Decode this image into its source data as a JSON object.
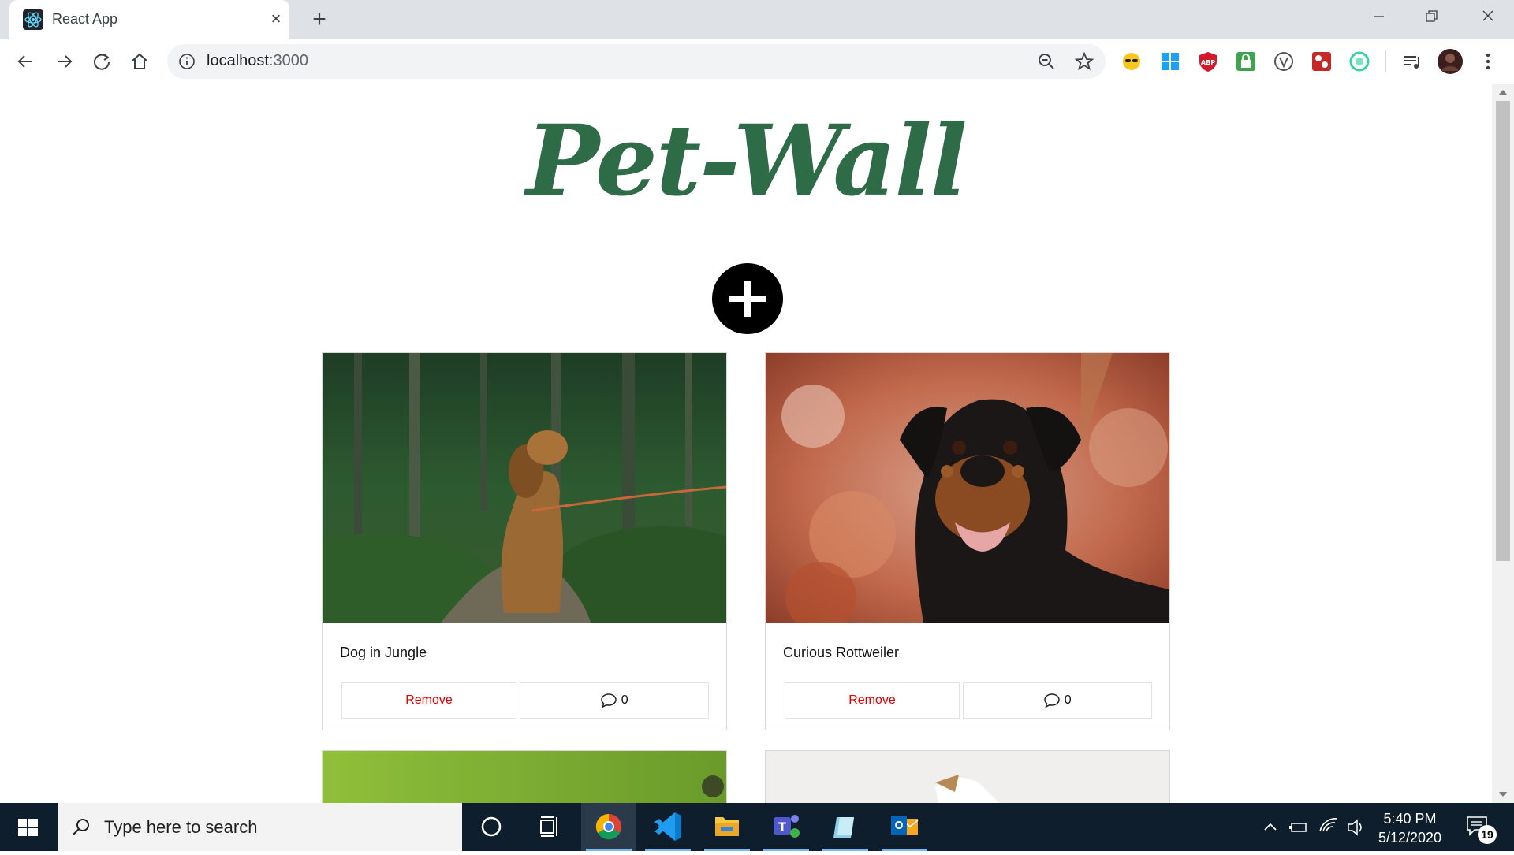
{
  "browser": {
    "tab_title": "React App",
    "url_host": "localhost",
    "url_port": ":3000"
  },
  "page": {
    "title": "Pet-Wall",
    "cards": [
      {
        "title": "Dog in Jungle",
        "remove_label": "Remove",
        "comment_count": "0"
      },
      {
        "title": "Curious Rottweiler",
        "remove_label": "Remove",
        "comment_count": "0"
      }
    ]
  },
  "taskbar": {
    "search_placeholder": "Type here to search",
    "time": "5:40 PM",
    "date": "5/12/2020",
    "notification_count": "19"
  },
  "colors": {
    "title_green": "#2e6b47",
    "remove_red": "#e00000",
    "taskbar_bg": "#0f1e2d"
  }
}
